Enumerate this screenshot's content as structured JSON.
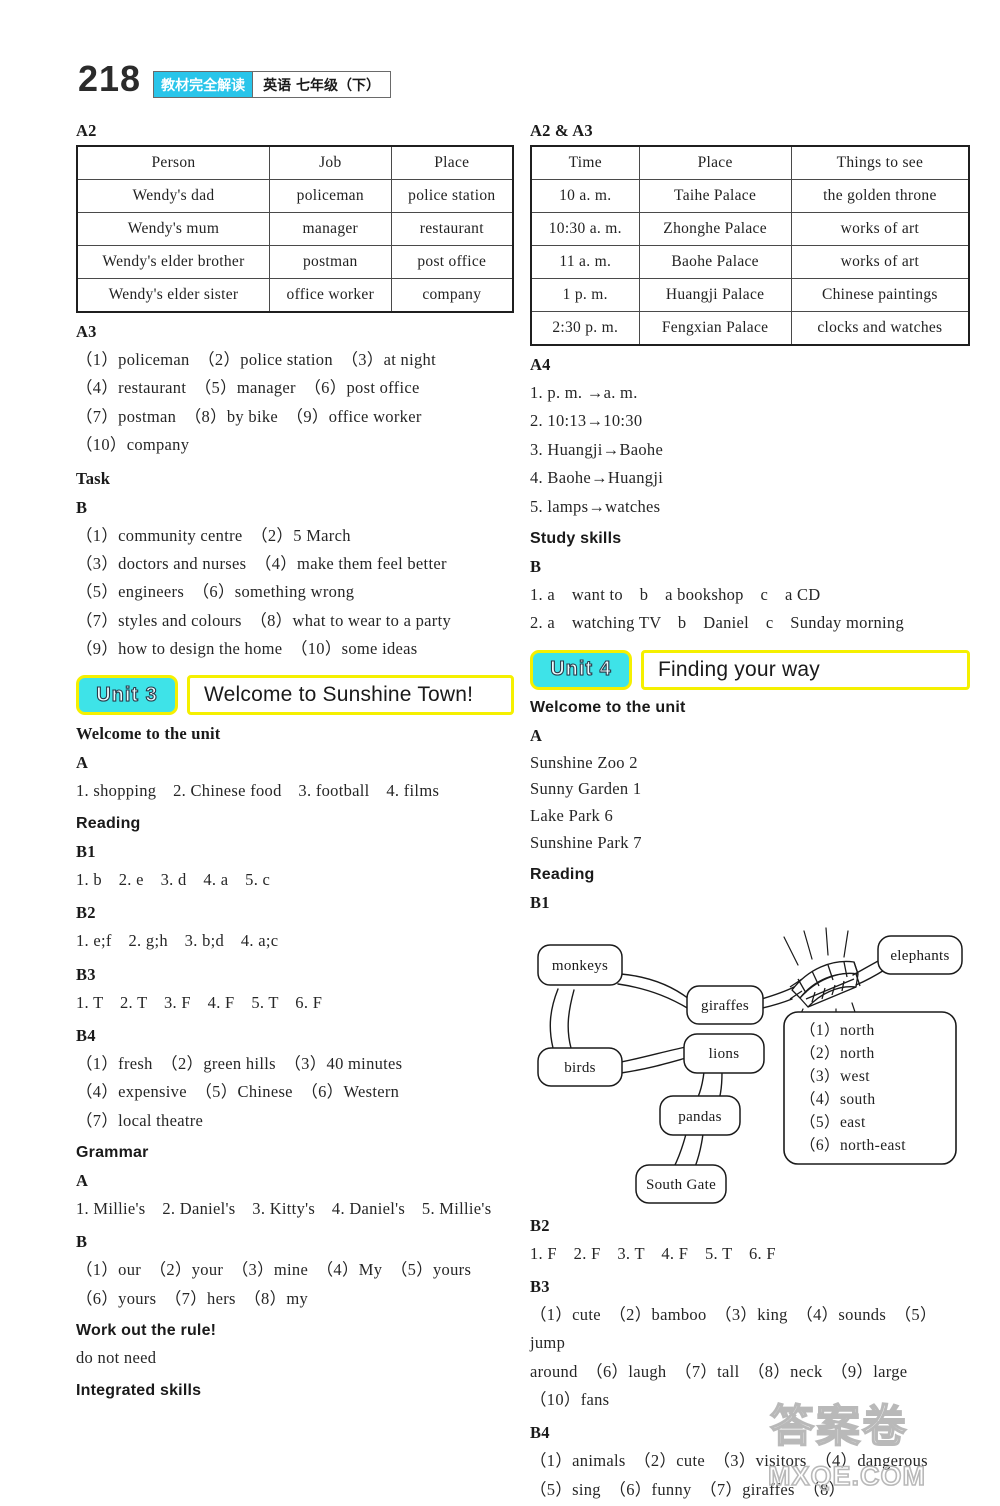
{
  "header": {
    "page_number": "218",
    "badge": "教材完全解读",
    "subject": "英语 七年级（下）"
  },
  "left_column": {
    "a2_heading": "A2",
    "a2_table": {
      "columns": [
        "Person",
        "Job",
        "Place"
      ],
      "rows": [
        [
          "Wendy's dad",
          "policeman",
          "police station"
        ],
        [
          "Wendy's mum",
          "manager",
          "restaurant"
        ],
        [
          "Wendy's elder brother",
          "postman",
          "post office"
        ],
        [
          "Wendy's elder sister",
          "office worker",
          "company"
        ]
      ]
    },
    "a3_heading": "A3",
    "a3_lines": [
      "（1）policeman　（2）police station　（3）at night",
      "（4）restaurant　（5）manager　（6）post office",
      "（7）postman　（8）by bike　（9）office worker",
      "（10）company"
    ],
    "task_heading": "Task",
    "task_b_heading": "B",
    "task_b_lines": [
      "（1）community centre　（2）5 March",
      "（3）doctors and nurses　（4）make them feel better",
      "（5）engineers　（6）something wrong",
      "（7）styles and colours　（8）what to wear to a party",
      "（9）how to design the home　（10）some ideas"
    ],
    "unit3": {
      "chip": "Unit 3",
      "title": "Welcome to Sunshine Town!"
    },
    "welcome_heading": "Welcome to the unit",
    "welcome_a_heading": "A",
    "welcome_a_line": "1. shopping　2. Chinese food　3. football　4. films",
    "reading_heading": "Reading",
    "b1_heading": "B1",
    "b1_line": "1. b　2. e　3. d　4. a　5. c",
    "b2_heading": "B2",
    "b2_line": "1. e;f　2. g;h　3. b;d　4. a;c",
    "b3_heading": "B3",
    "b3_line": "1. T　2. T　3. F　4. F　5. T　6. F",
    "b4_heading": "B4",
    "b4_lines": [
      "（1）fresh　（2）green hills　（3）40 minutes",
      "（4）expensive　（5）Chinese　（6）Western",
      "（7）local theatre"
    ],
    "grammar_heading": "Grammar",
    "grammar_a_heading": "A",
    "grammar_a_line": "1. Millie's　2. Daniel's　3. Kitty's　4. Daniel's　5. Millie's",
    "grammar_b_heading": "B",
    "grammar_b_lines": [
      "（1）our　（2）your　（3）mine　（4）My　（5）yours",
      "（6）yours　（7）hers　（8）my"
    ],
    "work_out_heading": "Work out the rule!",
    "work_out_line": "do not need",
    "integrated_heading": "Integrated skills"
  },
  "right_column": {
    "a2a3_heading": "A2 & A3",
    "a2a3_table": {
      "columns": [
        "Time",
        "Place",
        "Things to see"
      ],
      "rows": [
        [
          "10 a. m.",
          "Taihe Palace",
          "the golden throne"
        ],
        [
          "10:30 a. m.",
          "Zhonghe Palace",
          "works of art"
        ],
        [
          "11 a. m.",
          "Baohe Palace",
          "works of art"
        ],
        [
          "1 p. m.",
          "Huangji Palace",
          "Chinese paintings"
        ],
        [
          "2:30 p. m.",
          "Fengxian Palace",
          "clocks and watches"
        ]
      ]
    },
    "a4_heading": "A4",
    "a4_lines": [
      "1. p. m. →a. m.",
      "2. 10:13→10:30",
      "3. Huangji→Baohe",
      "4. Baohe→Huangji",
      "5. lamps→watches"
    ],
    "study_skills_heading": "Study skills",
    "study_b_heading": "B",
    "study_b_lines": [
      "1. a　want to　b　a bookshop　c　a CD",
      "2. a　watching TV　b　Daniel　c　Sunday morning"
    ],
    "unit4": {
      "chip": "Unit 4",
      "title": "Finding your way"
    },
    "welcome_heading": "Welcome to the unit",
    "welcome_a_heading": "A",
    "welcome_a_lines": [
      "Sunshine Zoo 2",
      "Sunny Garden 1",
      "Lake Park 6",
      "Sunshine Park 7"
    ],
    "reading_heading": "Reading",
    "b1_heading": "B1",
    "diagram": {
      "nodes": [
        {
          "id": "monkeys",
          "label": "monkeys"
        },
        {
          "id": "giraffes",
          "label": "giraffes"
        },
        {
          "id": "elephants",
          "label": "elephants"
        },
        {
          "id": "birds",
          "label": "birds"
        },
        {
          "id": "lions",
          "label": "lions"
        },
        {
          "id": "pandas",
          "label": "pandas"
        },
        {
          "id": "south_gate",
          "label": "South Gate"
        }
      ],
      "direction_answers": [
        "（1）north",
        "（2）north",
        "（3）west",
        "（4）south",
        "（5）east",
        "（6）north-east"
      ]
    },
    "b2_heading": "B2",
    "b2_line": "1. F　2. F　3. T　4. F　5. T　6. F",
    "b3_heading": "B3",
    "b3_lines": [
      "（1）cute　（2）bamboo　（3）king　（4）sounds　（5）jump",
      "around　（6）laugh　（7）tall　（8）neck　（9）large",
      "（10）fans"
    ],
    "b4_heading": "B4",
    "b4_lines": [
      "（1）animals　（2）cute　（3）visitors　（4）dangerous",
      "（5）sing　（6）funny　（7）giraffes　（8）"
    ]
  },
  "watermark": {
    "cn": "答案卷",
    "en": "MXQE.COM"
  }
}
